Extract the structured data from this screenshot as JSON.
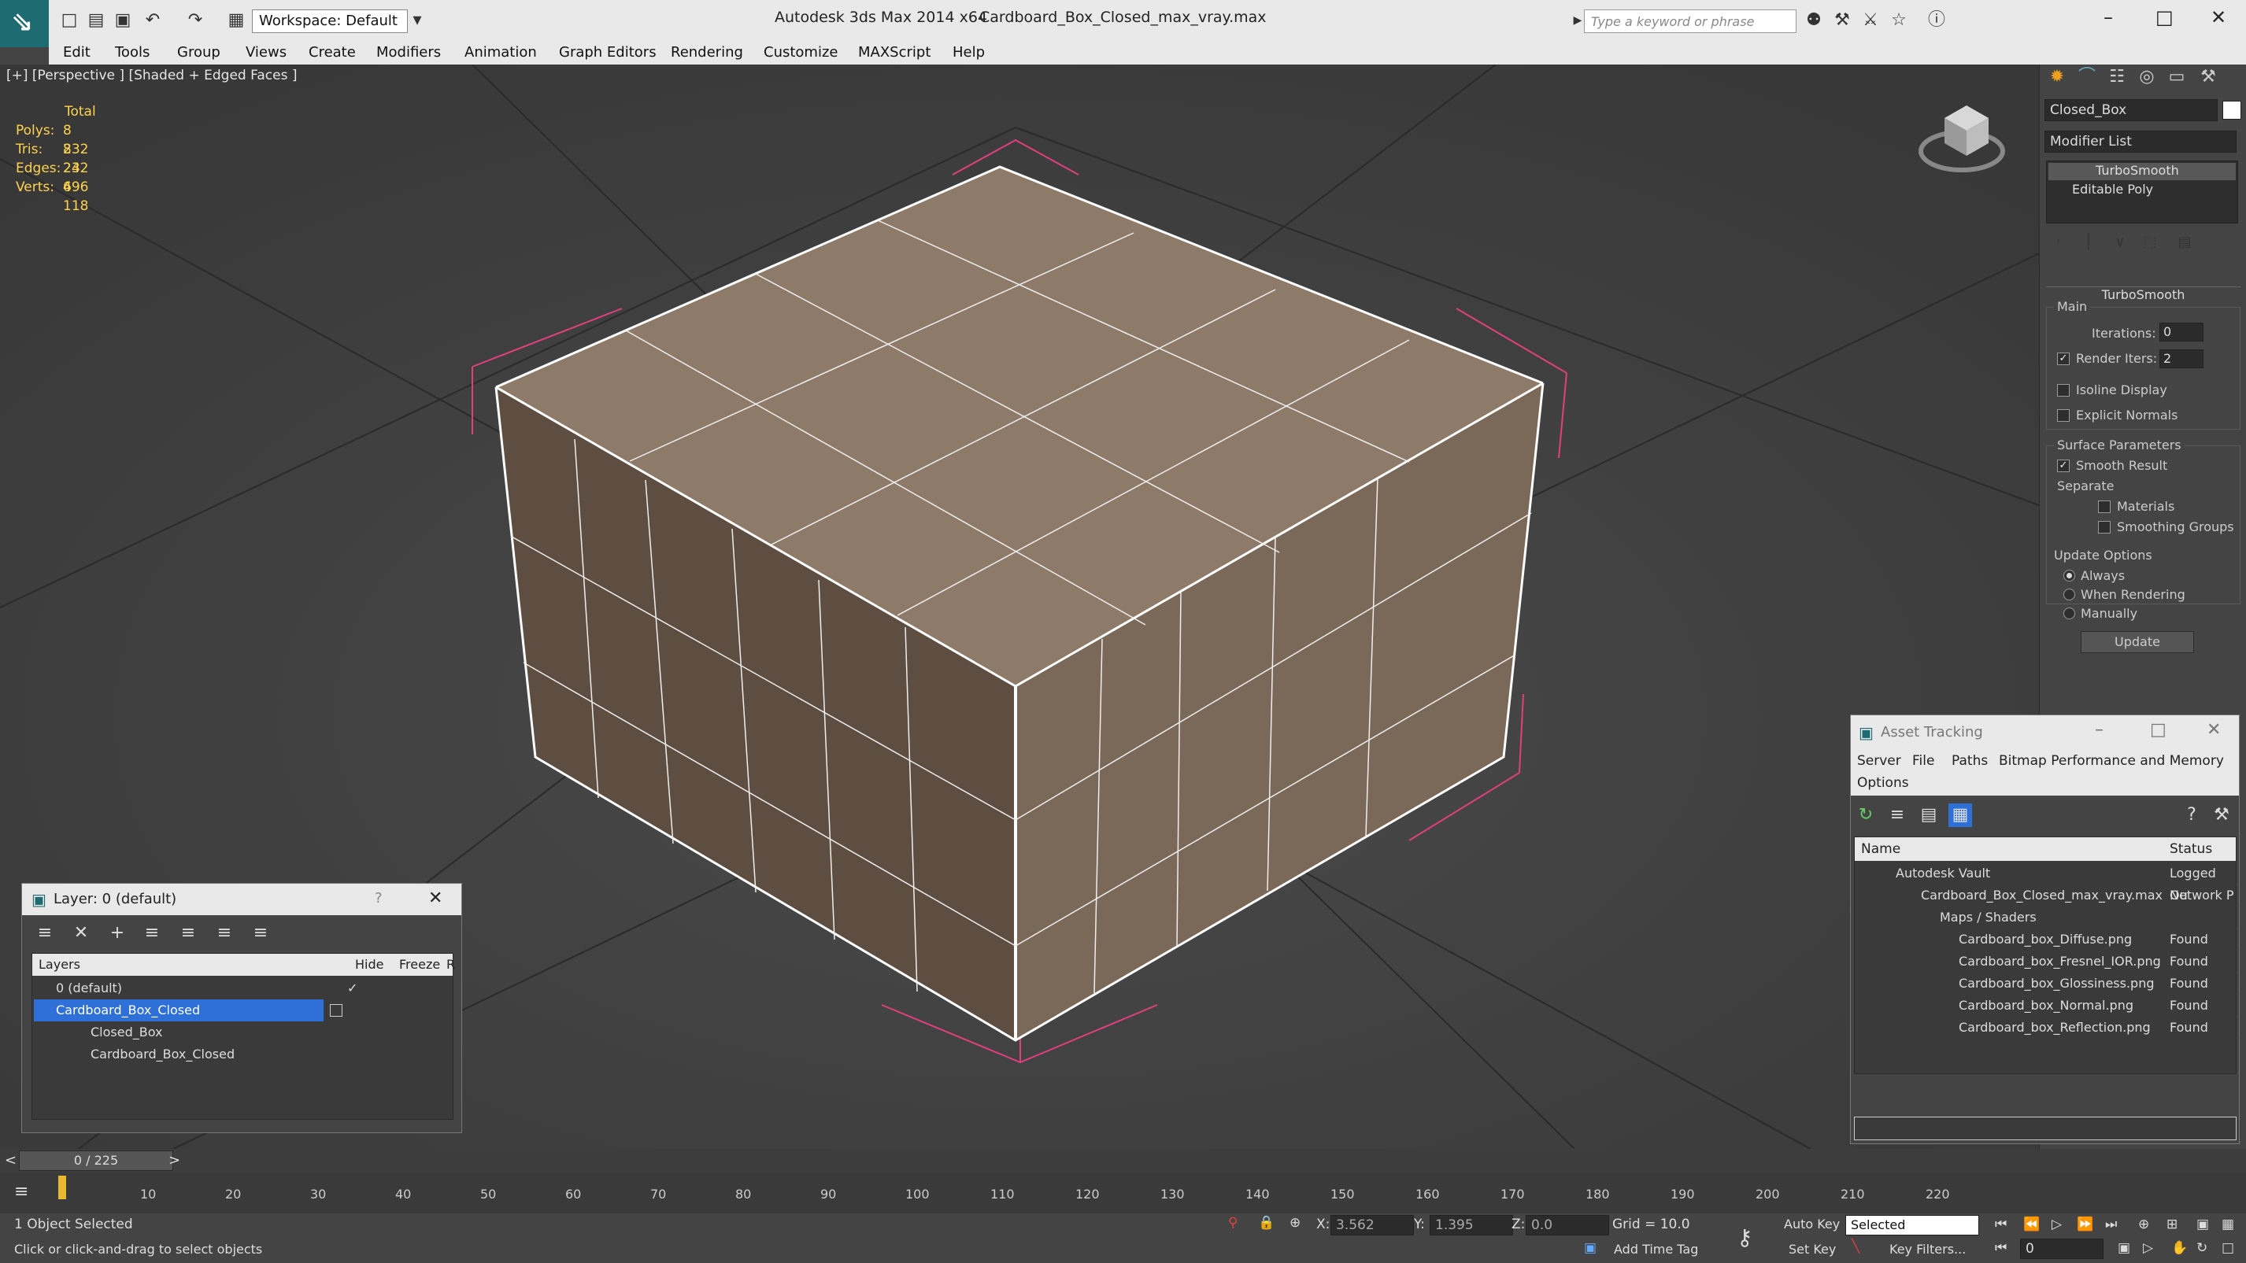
{
  "titlebar": {
    "app_title": "Autodesk 3ds Max  2014 x64",
    "file_name": "Cardboard_Box_Closed_max_vray.max",
    "workspace": "Workspace: Default",
    "search_placeholder": "Type a keyword or phrase"
  },
  "menu": [
    "Edit",
    "Tools",
    "Group",
    "Views",
    "Create",
    "Modifiers",
    "Animation",
    "Graph Editors",
    "Rendering",
    "Customize",
    "MAXScript",
    "Help"
  ],
  "viewport": {
    "label": "[+] [Perspective ] [Shaded + Edged Faces ]",
    "stats_header": "Total",
    "stats": [
      {
        "label": "Polys:",
        "value": "8 232"
      },
      {
        "label": "Tris:",
        "value": "8 232"
      },
      {
        "label": "Edges:",
        "value": "24 696"
      },
      {
        "label": "Verts:",
        "value": "4 118"
      }
    ]
  },
  "command_panel": {
    "object_name": "Closed_Box",
    "modifier_list": "Modifier List",
    "stack": [
      "TurboSmooth",
      "Editable Poly"
    ],
    "rollout_title": "TurboSmooth",
    "main_label": "Main",
    "iterations_label": "Iterations:",
    "iterations_value": "0",
    "render_iters_label": "Render Iters:",
    "render_iters_value": "2",
    "isoline_label": "Isoline Display",
    "explicit_normals_label": "Explicit Normals",
    "surface_params_label": "Surface Parameters",
    "smooth_result_label": "Smooth Result",
    "separate_label": "Separate",
    "materials_label": "Materials",
    "smoothing_groups_label": "Smoothing Groups",
    "update_options_label": "Update Options",
    "always_label": "Always",
    "when_rendering_label": "When Rendering",
    "manually_label": "Manually",
    "update_button": "Update"
  },
  "layer_dialog": {
    "title": "Layer: 0 (default)",
    "help": "?",
    "col_layers": "Layers",
    "col_hide": "Hide",
    "col_freeze": "Freeze",
    "col_extra": "R",
    "rows": [
      "0 (default)",
      "Cardboard_Box_Closed",
      "Closed_Box",
      "Cardboard_Box_Closed"
    ]
  },
  "asset_dialog": {
    "title": "Asset Tracking",
    "menu": [
      "Server",
      "File",
      "Paths",
      "Bitmap Performance and Memory",
      "Options"
    ],
    "col_name": "Name",
    "col_status": "Status",
    "rows": [
      {
        "name": "Autodesk Vault",
        "status": "Logged Ou"
      },
      {
        "name": "Cardboard_Box_Closed_max_vray.max",
        "status": "Network P"
      },
      {
        "name": "Maps / Shaders",
        "status": ""
      },
      {
        "name": "Cardboard_box_Diffuse.png",
        "status": "Found"
      },
      {
        "name": "Cardboard_box_Fresnel_IOR.png",
        "status": "Found"
      },
      {
        "name": "Cardboard_box_Glossiness.png",
        "status": "Found"
      },
      {
        "name": "Cardboard_box_Normal.png",
        "status": "Found"
      },
      {
        "name": "Cardboard_box_Reflection.png",
        "status": "Found"
      }
    ]
  },
  "timeline": {
    "frame_counter": "0 / 225",
    "ticks": [
      "10",
      "20",
      "30",
      "40",
      "50",
      "60",
      "70",
      "80",
      "90",
      "100",
      "110",
      "120",
      "130",
      "140",
      "150",
      "160",
      "170",
      "180",
      "190",
      "200",
      "210",
      "220"
    ]
  },
  "status": {
    "selection": "1 Object Selected",
    "prompt": "Click or click-and-drag to select objects",
    "x_label": "X:",
    "x_value": "3.562",
    "y_label": "Y:",
    "y_value": "1.395",
    "z_label": "Z:",
    "z_value": "0.0",
    "grid": "Grid = 10.0",
    "add_time_tag": "Add Time Tag",
    "auto_key": "Auto Key",
    "set_key": "Set Key",
    "selected_dropdown": "Selected",
    "key_filters": "Key Filters...",
    "frame_field": "0"
  },
  "colors": {
    "viewport_bg": "#404040",
    "stats_text": "#ffd34d",
    "selection_blue": "#2e6fd8",
    "bbox_pink": "#e0407a",
    "wire_white": "#ffffff"
  }
}
